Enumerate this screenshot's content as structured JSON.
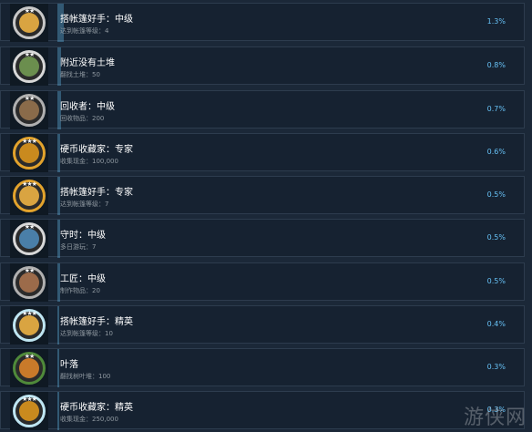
{
  "achievements": [
    {
      "title": "搭帐篷好手：中级",
      "desc": "达到帐篷等级：4",
      "percent": "1.3%",
      "progress_fraction": 0.013,
      "icon": "tent-icon",
      "stars": "★★",
      "ring_color": "#c8c8c8",
      "inner_color": "#d9a441"
    },
    {
      "title": "附近没有土堆",
      "desc": "翻找土堆：50",
      "percent": "0.8%",
      "progress_fraction": 0.008,
      "icon": "dirt-pile-icon",
      "stars": "★★",
      "ring_color": "#d8d8d8",
      "inner_color": "#6b8e4e"
    },
    {
      "title": "回收者：中级",
      "desc": "回收物品：200",
      "percent": "0.7%",
      "progress_fraction": 0.007,
      "icon": "recycle-icon",
      "stars": "★★",
      "ring_color": "#b0b0b0",
      "inner_color": "#8a6b4a"
    },
    {
      "title": "硬币收藏家：专家",
      "desc": "收集现金：100,000",
      "percent": "0.6%",
      "progress_fraction": 0.006,
      "icon": "coin-icon",
      "stars": "★★★",
      "ring_color": "#e3a32c",
      "inner_color": "#c98a1e"
    },
    {
      "title": "搭帐篷好手：专家",
      "desc": "达到帐篷等级：7",
      "percent": "0.5%",
      "progress_fraction": 0.005,
      "icon": "tent-icon",
      "stars": "★★★",
      "ring_color": "#e3a32c",
      "inner_color": "#d9a441"
    },
    {
      "title": "守时：中级",
      "desc": "多日游玩：7",
      "percent": "0.5%",
      "progress_fraction": 0.005,
      "icon": "clock-icon",
      "stars": "★★",
      "ring_color": "#d8d8d8",
      "inner_color": "#4a7fa8"
    },
    {
      "title": "工匠：中级",
      "desc": "制作物品：20",
      "percent": "0.5%",
      "progress_fraction": 0.005,
      "icon": "hammer-icon",
      "stars": "★★",
      "ring_color": "#b0b0b0",
      "inner_color": "#9c6b4a"
    },
    {
      "title": "搭帐篷好手：精英",
      "desc": "达到帐篷等级：10",
      "percent": "0.4%",
      "progress_fraction": 0.004,
      "icon": "tent-icon",
      "stars": "★★★",
      "ring_color": "#bfe6f2",
      "inner_color": "#d9a441"
    },
    {
      "title": "叶落",
      "desc": "翻找树叶堆：100",
      "percent": "0.3%",
      "progress_fraction": 0.003,
      "icon": "leaf-pile-icon",
      "stars": "★★",
      "ring_color": "#4f8a3a",
      "inner_color": "#c97a2a"
    },
    {
      "title": "硬币收藏家：精英",
      "desc": "收集现金：250,000",
      "percent": "0.3%",
      "progress_fraction": 0.003,
      "icon": "coin-icon",
      "stars": "★★★",
      "ring_color": "#bfe6f2",
      "inner_color": "#c98a1e"
    }
  ],
  "watermark": "游侠网",
  "colors": {
    "background": "#1b2838",
    "row_background": "#162231",
    "percent_text": "#66c0f4",
    "title_text": "#ffffff",
    "desc_text": "#8f98a0"
  }
}
